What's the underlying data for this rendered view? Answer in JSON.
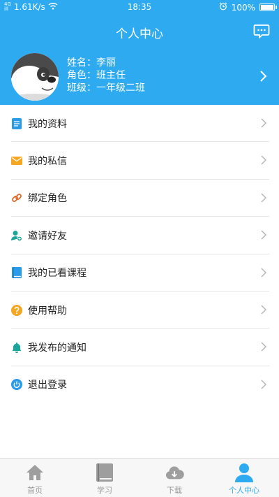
{
  "status_bar": {
    "signal_top": "4G",
    "signal_bottom": "ill",
    "speed": "1.61K/s",
    "time": "18:35",
    "battery": "100%",
    "battery_level": 1.0
  },
  "header": {
    "title": "个人中心",
    "profile": {
      "name_line": "姓名：李丽",
      "role_line": "角色：班主任",
      "class_line": "班级：一年级二班"
    }
  },
  "menu": {
    "items": [
      {
        "label": "我的资料",
        "icon": "document-icon",
        "color": "#2a9be8"
      },
      {
        "label": "我的私信",
        "icon": "mail-icon",
        "color": "#f5a623"
      },
      {
        "label": "绑定角色",
        "icon": "link-icon",
        "color": "#e06a2c"
      },
      {
        "label": "邀请好友",
        "icon": "add-user-icon",
        "color": "#1aa59a"
      },
      {
        "label": "我的已看课程",
        "icon": "book-icon",
        "color": "#2a9be8"
      },
      {
        "label": "使用帮助",
        "icon": "help-icon",
        "color": "#f5a623"
      },
      {
        "label": "我发布的通知",
        "icon": "bell-icon",
        "color": "#1aa59a"
      },
      {
        "label": "退出登录",
        "icon": "power-icon",
        "color": "#2a9be8"
      }
    ]
  },
  "tabbar": {
    "tabs": [
      {
        "label": "首页",
        "icon": "home-icon",
        "active": false
      },
      {
        "label": "学习",
        "icon": "book-icon",
        "active": false
      },
      {
        "label": "下载",
        "icon": "cloud-download-icon",
        "active": false
      },
      {
        "label": "个人中心",
        "icon": "person-icon",
        "active": true
      }
    ]
  },
  "colors": {
    "brand": "#2eaaf0",
    "inactive_tab": "#9e9e9e",
    "chevron": "#b8b8b8"
  }
}
